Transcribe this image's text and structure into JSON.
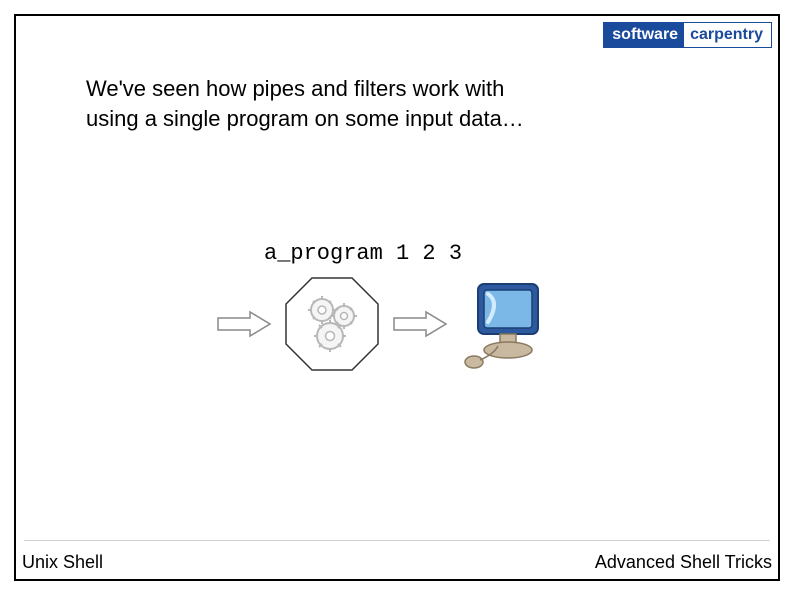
{
  "logo": {
    "left": "software",
    "right": "carpentry"
  },
  "body": {
    "line1": "We've seen how pipes and filters work with",
    "line2": "using a single program on some input data…"
  },
  "command": "a_program 1 2 3",
  "footer": {
    "left": "Unix Shell",
    "right": "Advanced Shell Tricks"
  }
}
